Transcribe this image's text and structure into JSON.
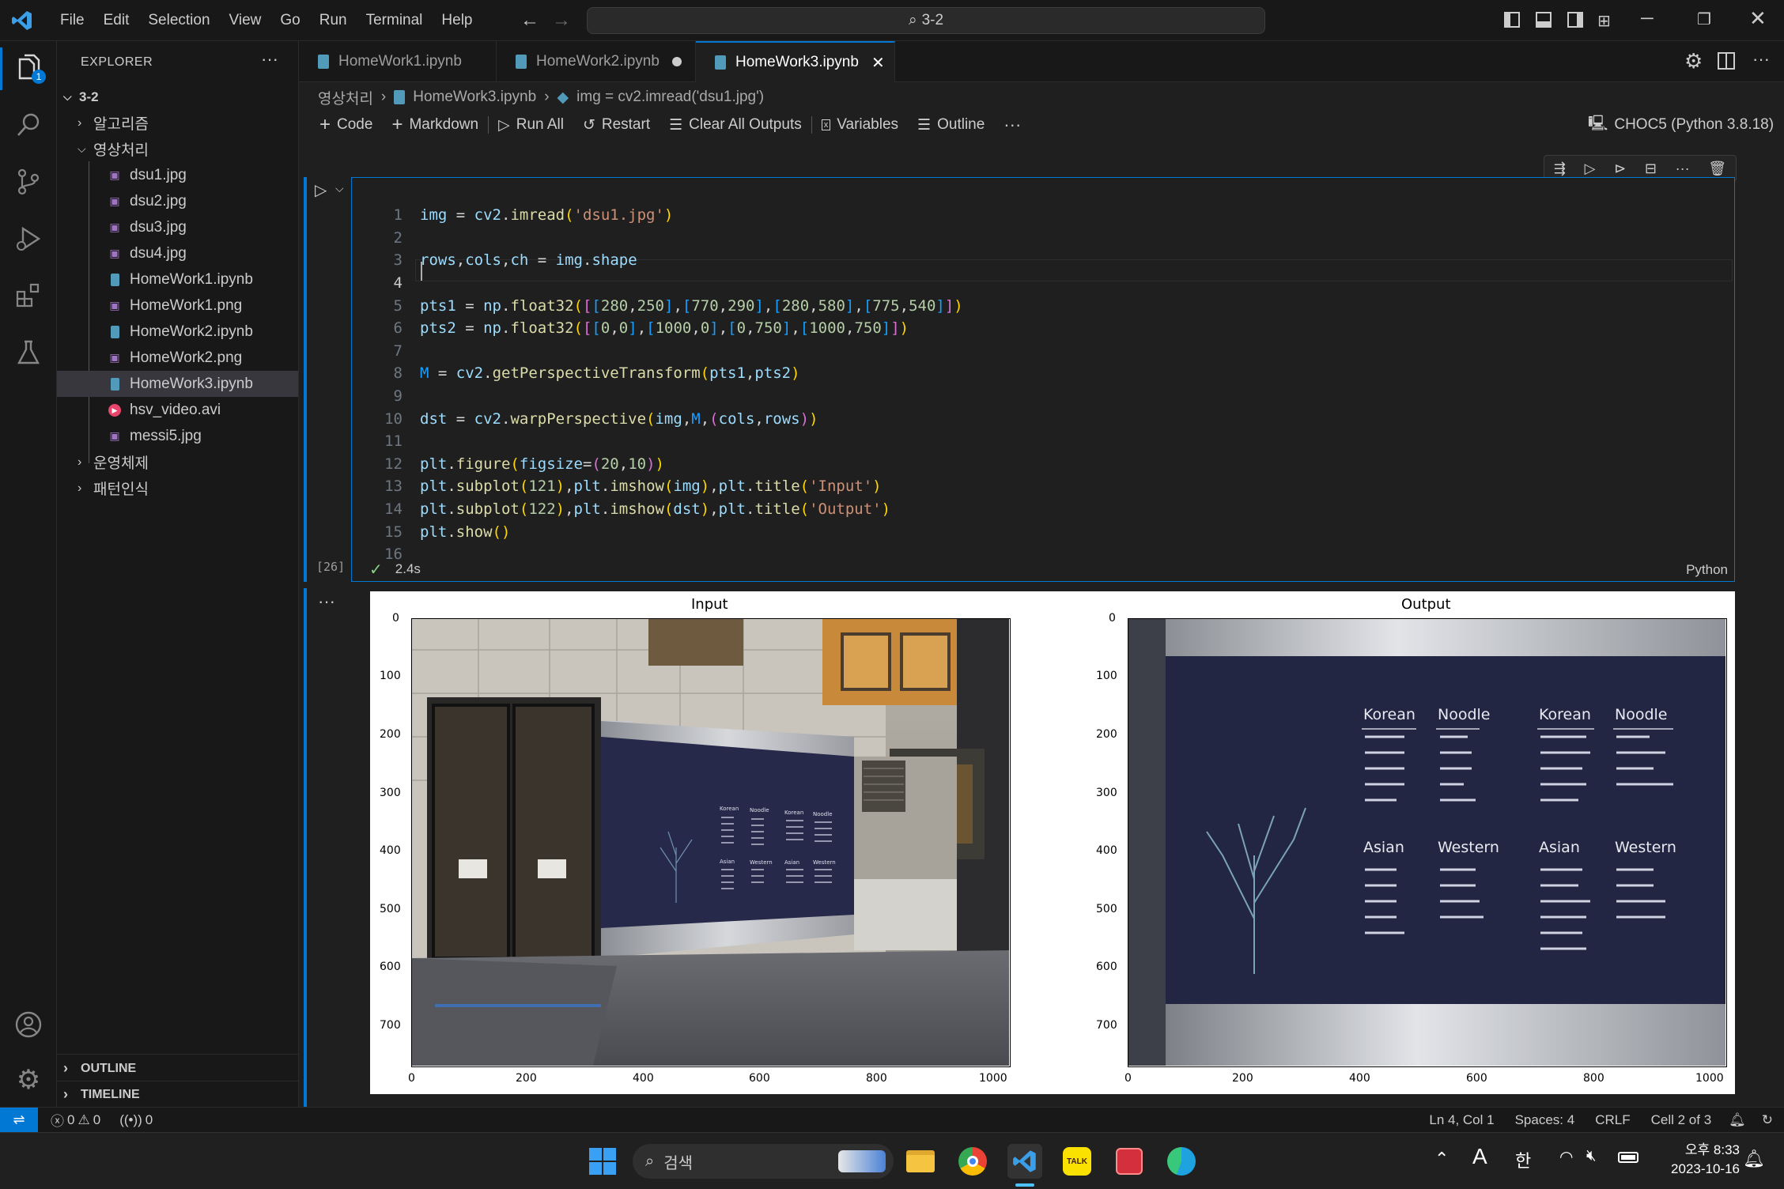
{
  "titlebar": {
    "menu": [
      "File",
      "Edit",
      "Selection",
      "View",
      "Go",
      "Run",
      "Terminal",
      "Help"
    ],
    "search": "3-2"
  },
  "activity": {
    "explorer_badge": "1"
  },
  "sidebar": {
    "title": "EXPLORER",
    "root": "3-2",
    "folders_top": [
      "알고리즘",
      "영상처리"
    ],
    "files": [
      "dsu1.jpg",
      "dsu2.jpg",
      "dsu3.jpg",
      "dsu4.jpg",
      "HomeWork1.ipynb",
      "HomeWork1.png",
      "HomeWork2.ipynb",
      "HomeWork2.png",
      "HomeWork3.ipynb",
      "hsv_video.avi",
      "messi5.jpg"
    ],
    "folders_bottom": [
      "운영체제",
      "패턴인식"
    ],
    "outline": "OUTLINE",
    "timeline": "TIMELINE"
  },
  "tabs": [
    "HomeWork1.ipynb",
    "HomeWork2.ipynb",
    "HomeWork3.ipynb"
  ],
  "breadcrumb": [
    "영상처리",
    "HomeWork3.ipynb",
    "img = cv2.imread('dsu1.jpg')"
  ],
  "toolbar": {
    "code": "Code",
    "markdown": "Markdown",
    "run_all": "Run All",
    "restart": "Restart",
    "clear": "Clear All Outputs",
    "variables": "Variables",
    "outline": "Outline",
    "kernel": "CHOC5 (Python 3.8.18)"
  },
  "cell": {
    "exec_count": "[26]",
    "time": "2.4s",
    "lang": "Python",
    "line_numbers": [
      "1",
      "2",
      "3",
      "4",
      "5",
      "6",
      "7",
      "8",
      "9",
      "10",
      "11",
      "12",
      "13",
      "14",
      "15",
      "16"
    ]
  },
  "chart_data": [
    {
      "type": "image",
      "title": "Input",
      "xticks": [
        "0",
        "200",
        "400",
        "600",
        "800",
        "1000"
      ],
      "yticks": [
        "0",
        "100",
        "200",
        "300",
        "400",
        "500",
        "600",
        "700"
      ],
      "xlim": [
        0,
        1024
      ],
      "ylim": [
        768,
        0
      ]
    },
    {
      "type": "image",
      "title": "Output",
      "xticks": [
        "0",
        "200",
        "400",
        "600",
        "800",
        "1000"
      ],
      "yticks": [
        "0",
        "100",
        "200",
        "300",
        "400",
        "500",
        "600",
        "700"
      ],
      "xlim": [
        0,
        1024
      ],
      "ylim": [
        768,
        0
      ]
    }
  ],
  "menu_board": {
    "headings": [
      "Korean",
      "Noodle",
      "Korean",
      "Noodle",
      "Asian",
      "Western",
      "Asian",
      "Western"
    ]
  },
  "statusbar": {
    "errors": "0",
    "warnings": "0",
    "ports": "0",
    "position": "Ln 4, Col 1",
    "spaces": "Spaces: 4",
    "eol": "CRLF",
    "cell": "Cell 2 of 3"
  },
  "taskbar": {
    "search": "검색",
    "ime": "한",
    "time": "오후 8:33",
    "date": "2023-10-16",
    "talk": "TALK"
  }
}
